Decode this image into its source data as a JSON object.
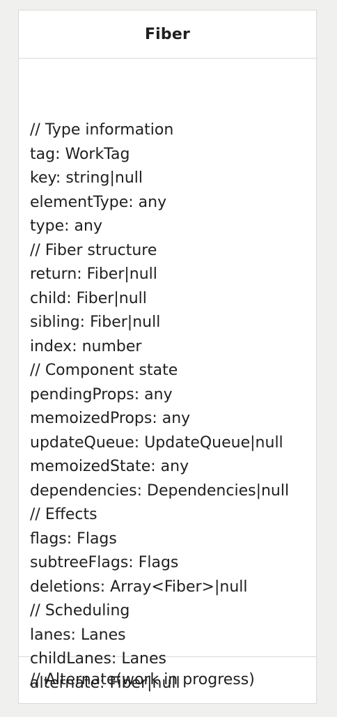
{
  "class": {
    "name": "Fiber",
    "attributes": [
      "// Type information",
      "tag: WorkTag",
      "key: string|null",
      "elementType: any",
      "type: any",
      "// Fiber structure",
      "return: Fiber|null",
      "child: Fiber|null",
      "sibling: Fiber|null",
      "index: number",
      "// Component state",
      "pendingProps: any",
      "memoizedProps: any",
      "updateQueue: UpdateQueue|null",
      "memoizedState: any",
      "dependencies: Dependencies|null",
      "// Effects",
      "flags: Flags",
      "subtreeFlags: Flags",
      "deletions: Array<Fiber>|null",
      "// Scheduling",
      "lanes: Lanes",
      "childLanes: Lanes",
      "alternate: Fiber|null"
    ],
    "operations": [
      "// Alternate(work in progress)"
    ]
  },
  "colors": {
    "background": "#f0f0ef",
    "box": "#ffffff",
    "border": "#d9d9d9",
    "text": "#1f1f1f"
  }
}
